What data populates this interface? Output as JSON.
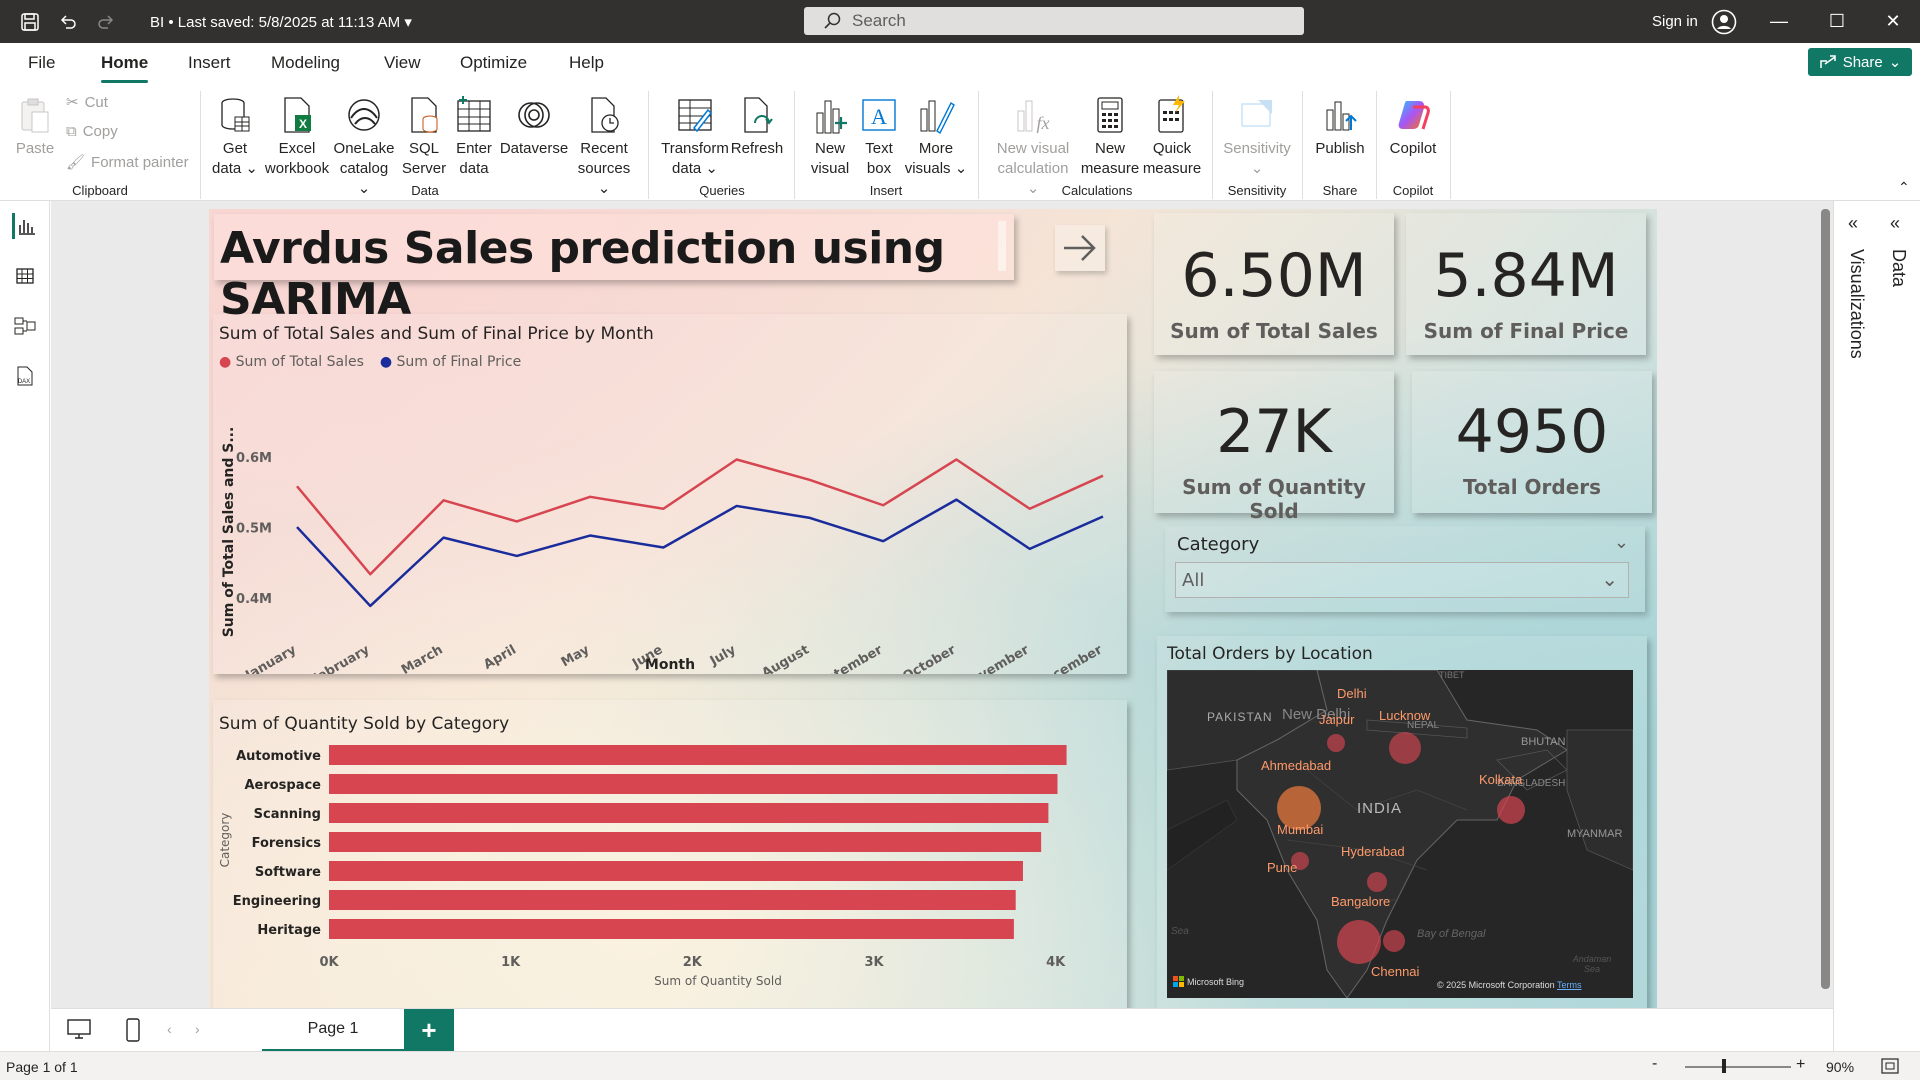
{
  "titlebar": {
    "doc_title": "BI  •  Last saved: 5/8/2025 at 11:13 AM",
    "search_placeholder": "Search",
    "signin": "Sign in"
  },
  "tabs": [
    "File",
    "Home",
    "Insert",
    "Modeling",
    "View",
    "Optimize",
    "Help"
  ],
  "share_label": "Share",
  "ribbon": {
    "clipboard": {
      "paste": "Paste",
      "cut": "Cut",
      "copy": "Copy",
      "format_painter": "Format painter",
      "group": "Clipboard"
    },
    "data": {
      "get_data": [
        "Get",
        "data ⌄"
      ],
      "excel": [
        "Excel",
        "workbook"
      ],
      "onelake": [
        "OneLake",
        "catalog ⌄"
      ],
      "sql": [
        "SQL",
        "Server"
      ],
      "enter": [
        "Enter",
        "data"
      ],
      "dataverse": [
        "Dataverse",
        ""
      ],
      "recent": [
        "Recent",
        "sources ⌄"
      ],
      "group": "Data"
    },
    "queries": {
      "transform": [
        "Transform",
        "data ⌄"
      ],
      "refresh": [
        "Refresh",
        ""
      ],
      "group": "Queries"
    },
    "insert": {
      "new_visual": [
        "New",
        "visual"
      ],
      "text_box": [
        "Text",
        "box"
      ],
      "more_visuals": [
        "More",
        "visuals ⌄"
      ],
      "group": "Insert"
    },
    "calculations": {
      "new_visual_calc": [
        "New visual",
        "calculation ⌄"
      ],
      "new_measure": [
        "New",
        "measure"
      ],
      "quick_measure": [
        "Quick",
        "measure"
      ],
      "group": "Calculations"
    },
    "sensitivity": {
      "label": [
        "Sensitivity",
        "⌄"
      ],
      "group": "Sensitivity"
    },
    "share": {
      "publish": [
        "Publish",
        ""
      ],
      "group": "Share"
    },
    "copilot": {
      "label": [
        "Copilot",
        ""
      ],
      "group": "Copilot"
    }
  },
  "report": {
    "title": "Avrdus Sales prediction using SARIMA",
    "line_chart_title": "Sum of Total Sales and Sum of Final Price by Month",
    "legend": [
      "Sum of Total Sales",
      "Sum of Final Price"
    ],
    "line_y_label": "Sum of Total Sales and S...",
    "line_x_label": "Month",
    "bar_chart_title": "Sum of Quantity Sold by Category",
    "bar_y_label": "Category",
    "bar_x_label": "Sum of Quantity Sold",
    "kpis": [
      {
        "value": "6.50M",
        "label": "Sum of Total Sales"
      },
      {
        "value": "5.84M",
        "label": "Sum of Final Price"
      },
      {
        "value": "27K",
        "label": "Sum of Quantity Sold"
      },
      {
        "value": "4950",
        "label": "Total Orders"
      }
    ],
    "slicer": {
      "title": "Category",
      "value": "All"
    },
    "map": {
      "title": "Total Orders by Location",
      "countries": [
        "PAKISTAN",
        "INDIA",
        "NEPAL",
        "BHUTAN",
        "BANGLADESH",
        "MYANMAR",
        "TIBET"
      ],
      "region_labels": [
        "New Delhi",
        "Bay of Bengal",
        "Sea",
        "Andaman Sea"
      ],
      "cities": [
        "Delhi",
        "Jaipur",
        "Lucknow",
        "Ahmedabad",
        "Kolkata",
        "Mumbai",
        "Hyderabad",
        "Pune",
        "Bangalore",
        "Chennai"
      ],
      "attribution": "Microsoft Bing",
      "copyright": "© 2025 Microsoft Corporation",
      "terms": "Terms"
    }
  },
  "colors": {
    "total_sales": "#d64550",
    "final_price": "#1a2b9b",
    "bar": "#d64550",
    "accent": "#117865"
  },
  "chart_data": [
    {
      "type": "line",
      "title": "Sum of Total Sales and Sum of Final Price by Month",
      "xlabel": "Month",
      "ylabel": "Sum of Total Sales and S...",
      "categories": [
        "January",
        "February",
        "March",
        "April",
        "May",
        "June",
        "July",
        "August",
        "September",
        "October",
        "November",
        "December"
      ],
      "yticks": [
        "0.4M",
        "0.5M",
        "0.6M"
      ],
      "ylim": [
        0.37,
        0.62
      ],
      "series": [
        {
          "name": "Sum of Total Sales",
          "values": [
            0.56,
            0.435,
            0.54,
            0.51,
            0.545,
            0.528,
            0.598,
            0.569,
            0.533,
            0.598,
            0.528,
            0.575
          ]
        },
        {
          "name": "Sum of Final Price",
          "values": [
            0.502,
            0.39,
            0.487,
            0.461,
            0.49,
            0.473,
            0.532,
            0.515,
            0.482,
            0.541,
            0.471,
            0.517
          ]
        }
      ]
    },
    {
      "type": "bar",
      "orientation": "horizontal",
      "title": "Sum of Quantity Sold by Category",
      "xlabel": "Sum of Quantity Sold",
      "ylabel": "Category",
      "categories": [
        "Automotive",
        "Aerospace",
        "Scanning",
        "Forensics",
        "Software",
        "Engineering",
        "Heritage"
      ],
      "values": [
        4060,
        4010,
        3960,
        3920,
        3820,
        3780,
        3770
      ],
      "xticks": [
        "0K",
        "1K",
        "2K",
        "3K",
        "4K"
      ],
      "xlim": [
        0,
        4200
      ]
    }
  ],
  "bottom": {
    "page_tab": "Page 1",
    "add": "+"
  },
  "status": {
    "page": "Page 1 of 1",
    "zoom": "90%"
  },
  "panels": {
    "visualizations": "Visualizations",
    "data": "Data"
  }
}
